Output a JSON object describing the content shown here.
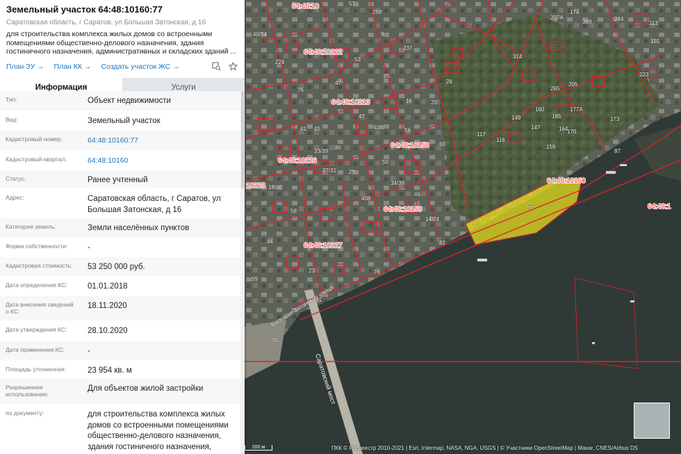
{
  "header": {
    "title": "Земельный участок 64:48:10160:77",
    "address": "Саратовская область, г Саратов, ул Большая Затонская, д 16",
    "description": "для строительства комплекса жилых домов со встроенными помещениями общественно-делового назначения, здания гостиничного назначения, административных и складских зданий ..."
  },
  "links": {
    "plan_zu": "План ЗУ →",
    "plan_kk": "План КК →",
    "create_zhs": "Создать участок ЖС →"
  },
  "icons": {
    "zoom": "zoom-to-icon",
    "favorite": "star-icon"
  },
  "tabs": {
    "info": "Информация",
    "services": "Услуги"
  },
  "rows": [
    {
      "label": "Тип:",
      "value": "Объект недвижимости"
    },
    {
      "label": "Вид:",
      "value": "Земельный участок"
    },
    {
      "label": "Кадастровый номер:",
      "value": "64:48:10160:77"
    },
    {
      "label": "Кадастровый квартал:",
      "value": "64:48:10160"
    },
    {
      "label": "Статус:",
      "value": "Ранее учтенный"
    },
    {
      "label": "Адрес:",
      "value": "Саратовская область, г Саратов, ул Большая Затонская, д 16"
    },
    {
      "label": "Категория земель:",
      "value": "Земли населённых пунктов"
    },
    {
      "label": "Форма собственности:",
      "value": "-"
    },
    {
      "label": "Кадастровая стоимость:",
      "value": "53 250 000 руб."
    },
    {
      "label": "Дата определения КС:",
      "value": "01.01.2018"
    },
    {
      "label": "Дата внесения сведений о КС:",
      "value": "18.11.2020"
    },
    {
      "label": "Дата утверждения КС:",
      "value": "28.10.2020"
    },
    {
      "label": "Дата применения КС:",
      "value": "-"
    },
    {
      "label": "Площадь уточненная:",
      "value": "23 954 кв. м"
    },
    {
      "label": "Разрешенное использование:",
      "value": "Для объектов жилой застройки"
    },
    {
      "label": "по документу:",
      "value": "для строительства комплекса жилых домов со встроенными помещениями общественно-делового назначения, здания гостиничного назначения,"
    }
  ],
  "map": {
    "cadastral_labels": [
      "64:48:10222",
      "64:48:10213",
      "64:48:10158",
      "64:48:10226",
      "64:48:10227",
      "64:48:10159",
      "64:48:10160",
      "64:48:1",
      "64:48:10",
      "10228"
    ],
    "street_labels": [
      "Большая Затонская улица",
      "Саратовский мост"
    ],
    "parcel_numbers": [
      "57",
      "258",
      "40/54",
      "224",
      "76",
      "85",
      "337",
      "16",
      "86",
      "53",
      "47",
      "47",
      "41",
      "45",
      "33/39",
      "27/31",
      "25",
      "408",
      "50",
      "43B",
      "56",
      "34/38",
      "9",
      "18/40",
      "20",
      "28",
      "60",
      "174",
      "297A",
      "389",
      "244",
      "113",
      "155",
      "314",
      "223",
      "265",
      "205",
      "177A",
      "185",
      "147",
      "159",
      "173",
      "87",
      "117",
      "116",
      "149",
      "160",
      "164",
      "170",
      "82",
      "76",
      "81",
      "59",
      "70",
      "23",
      "77",
      "14/24",
      "46",
      "58",
      "44"
    ],
    "attribution": "ПКК © Росреестр 2010-2021 | Esri, Intermap, NASA, NGA, USGS | © Участники OpenStreetMap | Maxar, CNES/Airbus DS",
    "scale": "200 м",
    "highlight_color": "#e8e020",
    "boundary_color": "#e0222a"
  }
}
